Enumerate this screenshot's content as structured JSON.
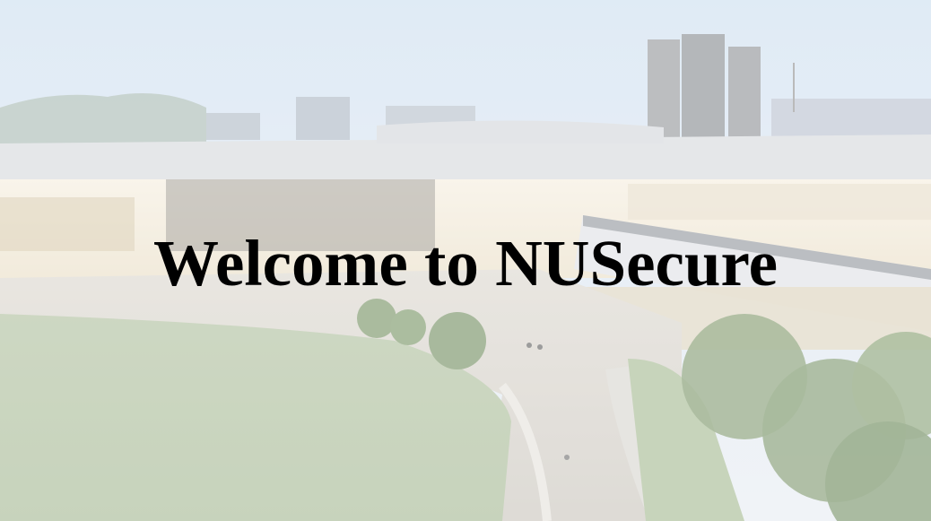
{
  "hero": {
    "title": "Welcome to NUSecure"
  },
  "colors": {
    "title_text": "#000000",
    "sky_top": "#cfe0ef",
    "sky_bottom": "#e9edf2",
    "lawn": "#b8c8a8",
    "building_glow": "#f3ead8"
  },
  "background": {
    "icon": "campus-photo"
  }
}
